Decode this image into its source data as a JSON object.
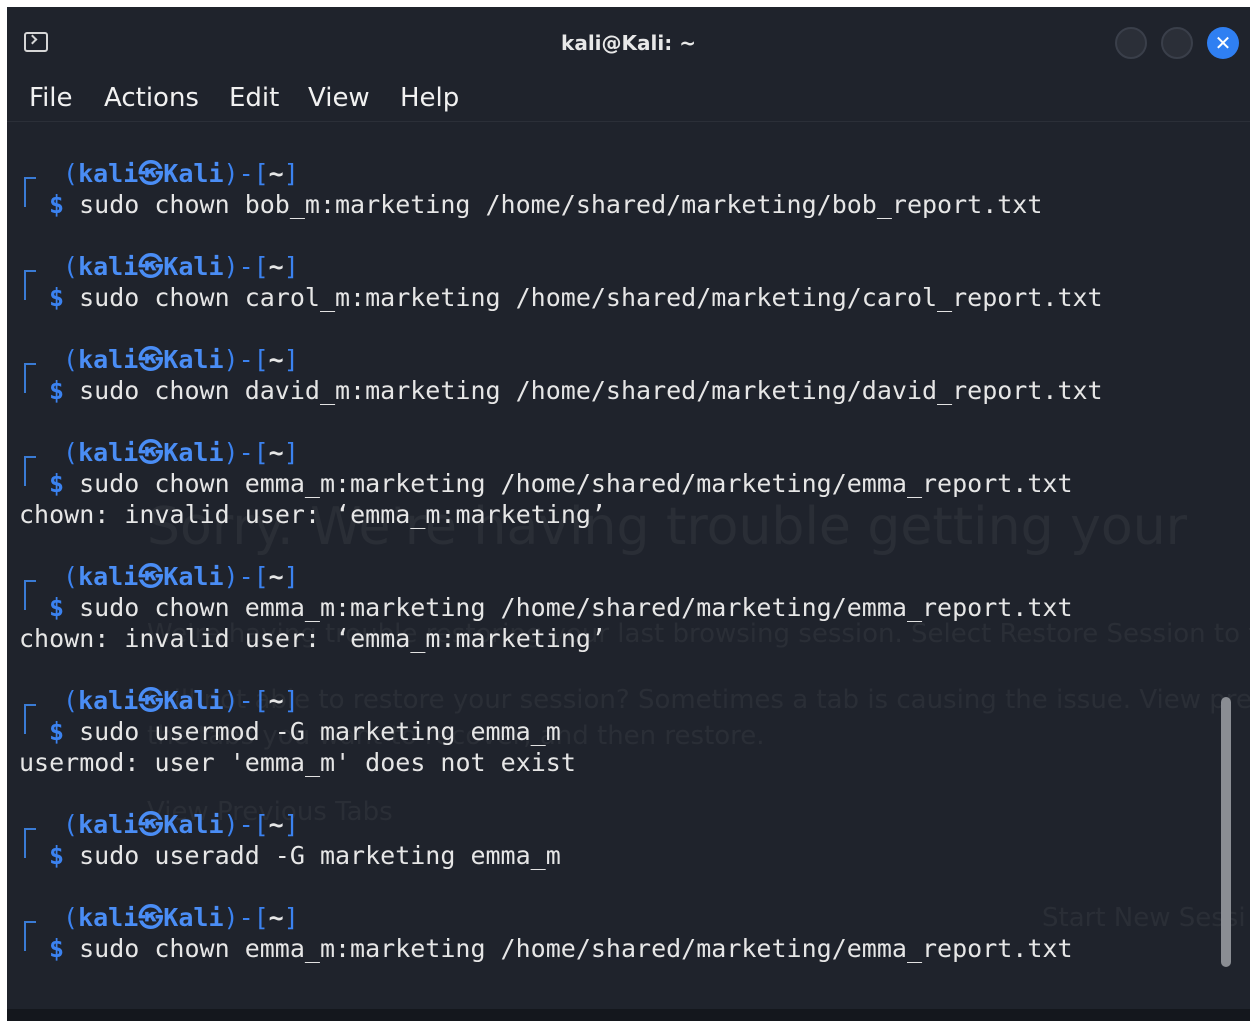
{
  "window": {
    "title": "kali@Kali: ~",
    "close_glyph": "✕"
  },
  "menu": {
    "items": [
      "File",
      "Actions",
      "Edit",
      "View",
      "Help"
    ]
  },
  "prompt": {
    "open": "(",
    "user": "kali",
    "at": "㉿",
    "host": "Kali",
    "mid": ")-[",
    "dir": "~",
    "close": "]",
    "symbol": "$"
  },
  "commands": [
    {
      "cmd": "sudo chown bob_m:marketing /home/shared/marketing/bob_report.txt",
      "output": ""
    },
    {
      "cmd": "sudo chown carol_m:marketing /home/shared/marketing/carol_report.txt",
      "output": ""
    },
    {
      "cmd": "sudo chown david_m:marketing /home/shared/marketing/david_report.txt",
      "output": ""
    },
    {
      "cmd": "sudo chown emma_m:marketing /home/shared/marketing/emma_report.txt",
      "output": "chown: invalid user: ‘emma_m:marketing’"
    },
    {
      "cmd": "sudo chown emma_m:marketing /home/shared/marketing/emma_report.txt",
      "output": "chown: invalid user: ‘emma_m:marketing’"
    },
    {
      "cmd": "sudo usermod -G marketing emma_m",
      "output": "usermod: user 'emma_m' does not exist"
    },
    {
      "cmd": "sudo useradd -G marketing emma_m",
      "output": ""
    },
    {
      "cmd": "sudo chown emma_m:marketing /home/shared/marketing/emma_report.txt",
      "output": ""
    }
  ],
  "background_overlay": {
    "heading": "Sorry. We're having trouble getting your",
    "line1": "We're having trouble restoring your last browsing session. Select Restore Session to t",
    "line2": "Still not able to restore your session? Sometimes a tab is causing the issue. View previo",
    "line3": "the tabs you want to recover, and then restore.",
    "view_tabs": "View Previous Tabs",
    "new_session": "Start New Sessi"
  }
}
